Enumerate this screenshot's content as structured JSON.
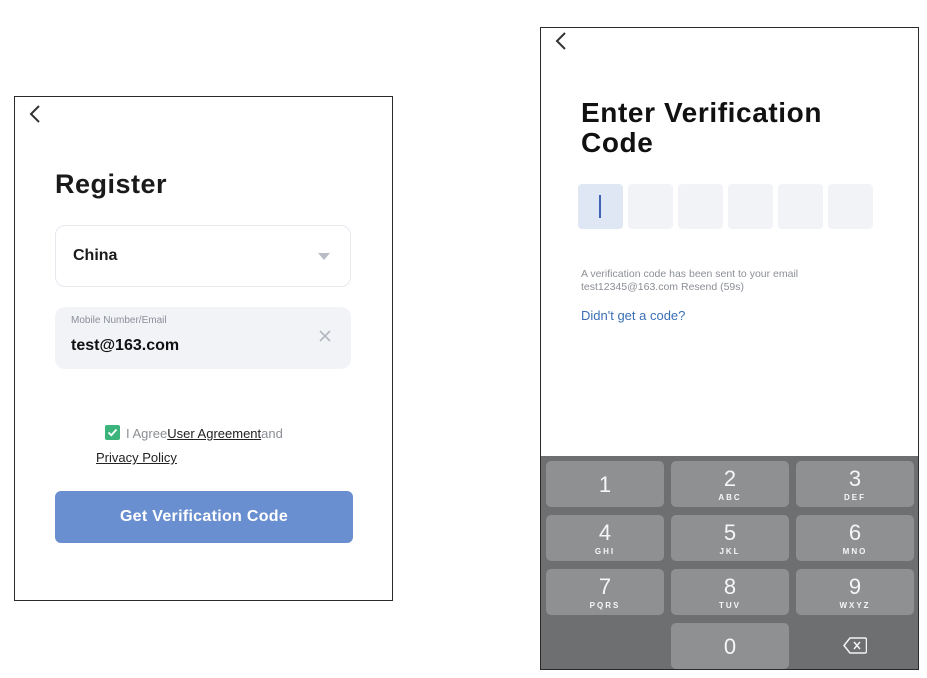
{
  "register": {
    "title": "Register",
    "country": "China",
    "field_label": "Mobile Number/Email",
    "field_value": "test@163.com",
    "agree_prefix": "I Agree",
    "user_agreement": "User Agreement",
    "agree_and": "and",
    "privacy_policy": "Privacy Policy",
    "button_label": "Get Verification Code",
    "agreement_checked": true
  },
  "verify": {
    "title": "Enter Verification Code",
    "message_line1": "A verification code has been sent to your email",
    "message_email": "test12345@163.com",
    "resend": "Resend (59s)",
    "no_code_link": "Didn't get a code?",
    "code_length": 6
  },
  "keypad": {
    "keys": [
      {
        "digit": "1",
        "letters": ""
      },
      {
        "digit": "2",
        "letters": "ABC"
      },
      {
        "digit": "3",
        "letters": "DEF"
      },
      {
        "digit": "4",
        "letters": "GHI"
      },
      {
        "digit": "5",
        "letters": "JKL"
      },
      {
        "digit": "6",
        "letters": "MNO"
      },
      {
        "digit": "7",
        "letters": "PQRS"
      },
      {
        "digit": "8",
        "letters": "TUV"
      },
      {
        "digit": "9",
        "letters": "WXYZ"
      },
      {
        "digit": "0",
        "letters": ""
      }
    ]
  },
  "colors": {
    "primary_button": "#6a8fd0",
    "checkbox": "#3cb57c",
    "link": "#3a6fb5",
    "keypad_bg": "#6e6f71",
    "key_bg": "#8f9092"
  },
  "icons": {
    "back": "chevron-left-icon",
    "dropdown": "caret-down-icon",
    "clear": "close-icon",
    "check": "check-icon",
    "delete": "backspace-icon"
  }
}
